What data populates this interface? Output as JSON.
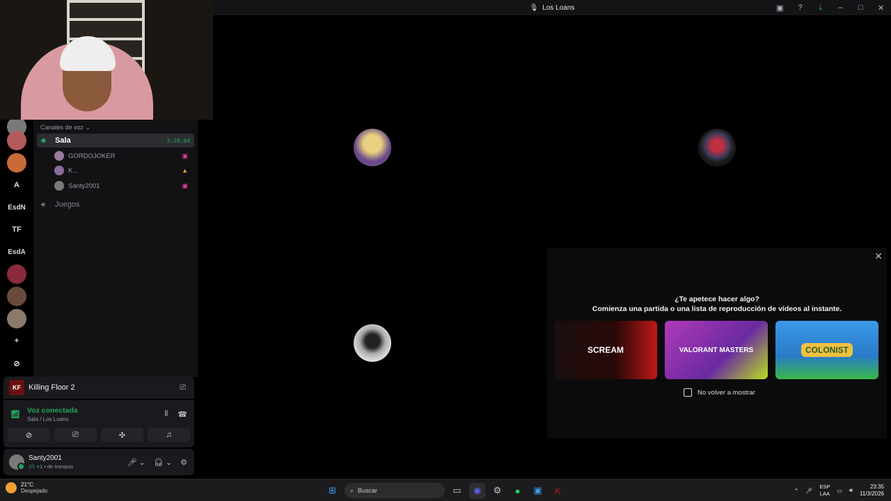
{
  "window": {
    "title": "Los Loans",
    "actions": [
      "cast-icon",
      "help-icon",
      "download-icon",
      "minimize-icon",
      "maximize-icon",
      "close-icon"
    ]
  },
  "servers": [
    {
      "label": "",
      "color": "#7a7a7a"
    },
    {
      "label": "",
      "color": "#b55a5a"
    },
    {
      "label": "",
      "color": "#c96a3a"
    },
    {
      "label": "A",
      "color": ""
    },
    {
      "label": "EsdN",
      "color": ""
    },
    {
      "label": "TF",
      "color": ""
    },
    {
      "label": "EsdA",
      "color": ""
    },
    {
      "label": "",
      "color": "#8a2a3a"
    },
    {
      "label": "",
      "color": "#6a4a3a"
    },
    {
      "label": "",
      "color": "#8a7a6a"
    },
    {
      "label": "+",
      "color": ""
    },
    {
      "label": "⊘",
      "color": ""
    }
  ],
  "sidebar": {
    "category": "Canales de voz",
    "channels": [
      {
        "name": "Sala",
        "time": "3:28:04"
      },
      {
        "name": "Juegos",
        "time": ""
      }
    ],
    "members": [
      {
        "name": "GORDOJOKER",
        "avatar_color": "#9a7aa0"
      },
      {
        "name": "K...",
        "avatar_color": "#8a6a9a"
      },
      {
        "name": "Santy2001",
        "avatar_color": "#7a7a7a"
      }
    ]
  },
  "activity": {
    "game_icon_label": "KF",
    "game_name": "Killing Floor 2"
  },
  "voice": {
    "status": "Voz conectada",
    "location": "Sala / Los Loans"
  },
  "user": {
    "name": "Santy2001",
    "status": "+1 • de tranquis"
  },
  "tiles": [
    {
      "bg": "#4a3458"
    },
    {
      "bg": "#c596a5"
    },
    {
      "bg": "#7a7a7a"
    }
  ],
  "invite": {
    "line1": "¿Te apetece hacer algo?",
    "line2": "Comienza una partida o una lista de reproducción de vídeos al instante.",
    "cards": [
      {
        "label": "SCREAM",
        "bg": "#1a0e0e",
        "accent": "#c01818"
      },
      {
        "label": "VALORANT MASTERS",
        "bg": "#7a3aa8",
        "accent": "#b8e020"
      },
      {
        "label": "COLONIST",
        "bg": "#3a8ad8",
        "accent": "#f0c040"
      }
    ],
    "checkbox_label": "No volver a mostrar"
  },
  "taskbar": {
    "temperature": "21°C",
    "weather": "Despejado",
    "search_placeholder": "Buscar",
    "lang1": "ESP",
    "lang2": "LAA",
    "time": "23:35",
    "date": "11/3/2026"
  }
}
